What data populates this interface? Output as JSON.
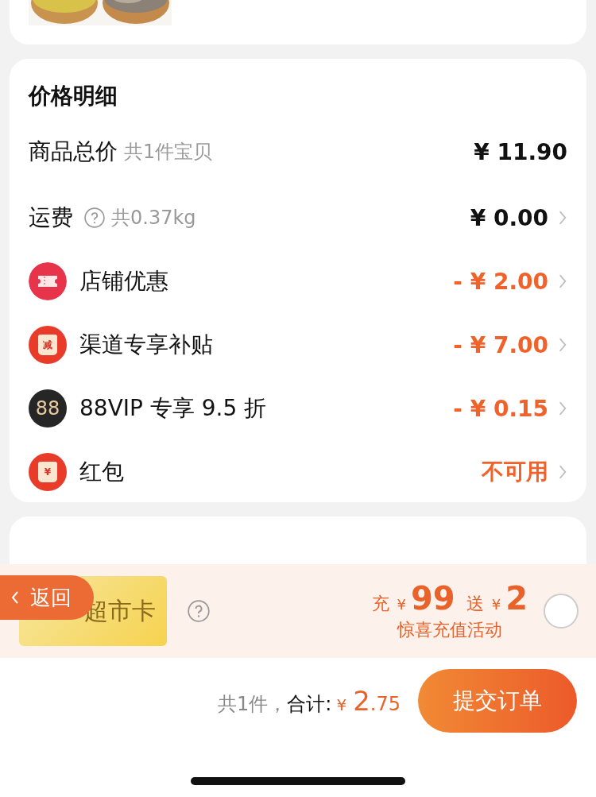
{
  "price_detail": {
    "title": "价格明细",
    "rows": [
      {
        "kind": "plain",
        "label": "商品总价",
        "note": "共1件宝贝",
        "help": false,
        "value": "¥ 11.90",
        "discount": false,
        "arrow": false
      },
      {
        "kind": "plain",
        "label": "运费",
        "note": "共0.37kg",
        "help": true,
        "value": "¥ 0.00",
        "discount": false,
        "arrow": true
      },
      {
        "kind": "ticket",
        "label": "店铺优惠",
        "value": "- ¥ 2.00",
        "discount": true,
        "arrow": true
      },
      {
        "kind": "envelope",
        "badge": "减",
        "label": "渠道专享补贴",
        "value": "- ¥ 7.00",
        "discount": true,
        "arrow": true
      },
      {
        "kind": "vip",
        "badge": "88",
        "label": "88VIP 专享 9.5 折",
        "value": "- ¥ 0.15",
        "discount": true,
        "arrow": true
      },
      {
        "kind": "envelope",
        "badge": "¥",
        "label": "红包",
        "value": "不可用",
        "discount": true,
        "arrow": true
      }
    ]
  },
  "promo": {
    "card_label": "超市卡",
    "back_button": "返回",
    "charge_label": "充",
    "charge_currency": "¥",
    "charge_amount": "99",
    "gift_label": "送",
    "gift_currency": "¥",
    "gift_amount": "2",
    "subtitle": "惊喜充值活动",
    "selected": false
  },
  "footer": {
    "count": "共1件，",
    "total_label": "合计:",
    "currency": "¥",
    "total_int": "2",
    "total_dec": ".75",
    "submit": "提交订单"
  }
}
